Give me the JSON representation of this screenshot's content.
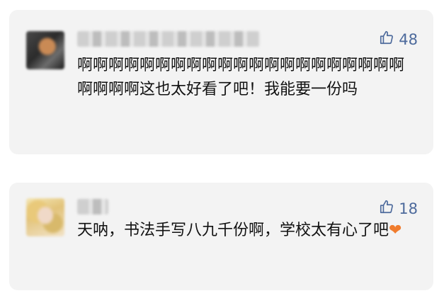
{
  "comments": [
    {
      "likes": "48",
      "text": "啊啊啊啊啊啊啊啊啊啊啊啊啊啊啊啊啊啊啊啊啊啊啊啊啊这也太好看了吧！我能要一份吗"
    },
    {
      "likes": "18",
      "text": "天呐，书法手写八九千份啊，学校太有心了吧",
      "emoji": "❤",
      "emoji_name": "orange-heart-emoji"
    }
  ],
  "icons": {
    "like": "thumbs-up-icon"
  },
  "colors": {
    "card_bg": "#f3f3f3",
    "like_accent": "#4d6a9c",
    "text": "#111111",
    "heart": "#f07c2e"
  }
}
